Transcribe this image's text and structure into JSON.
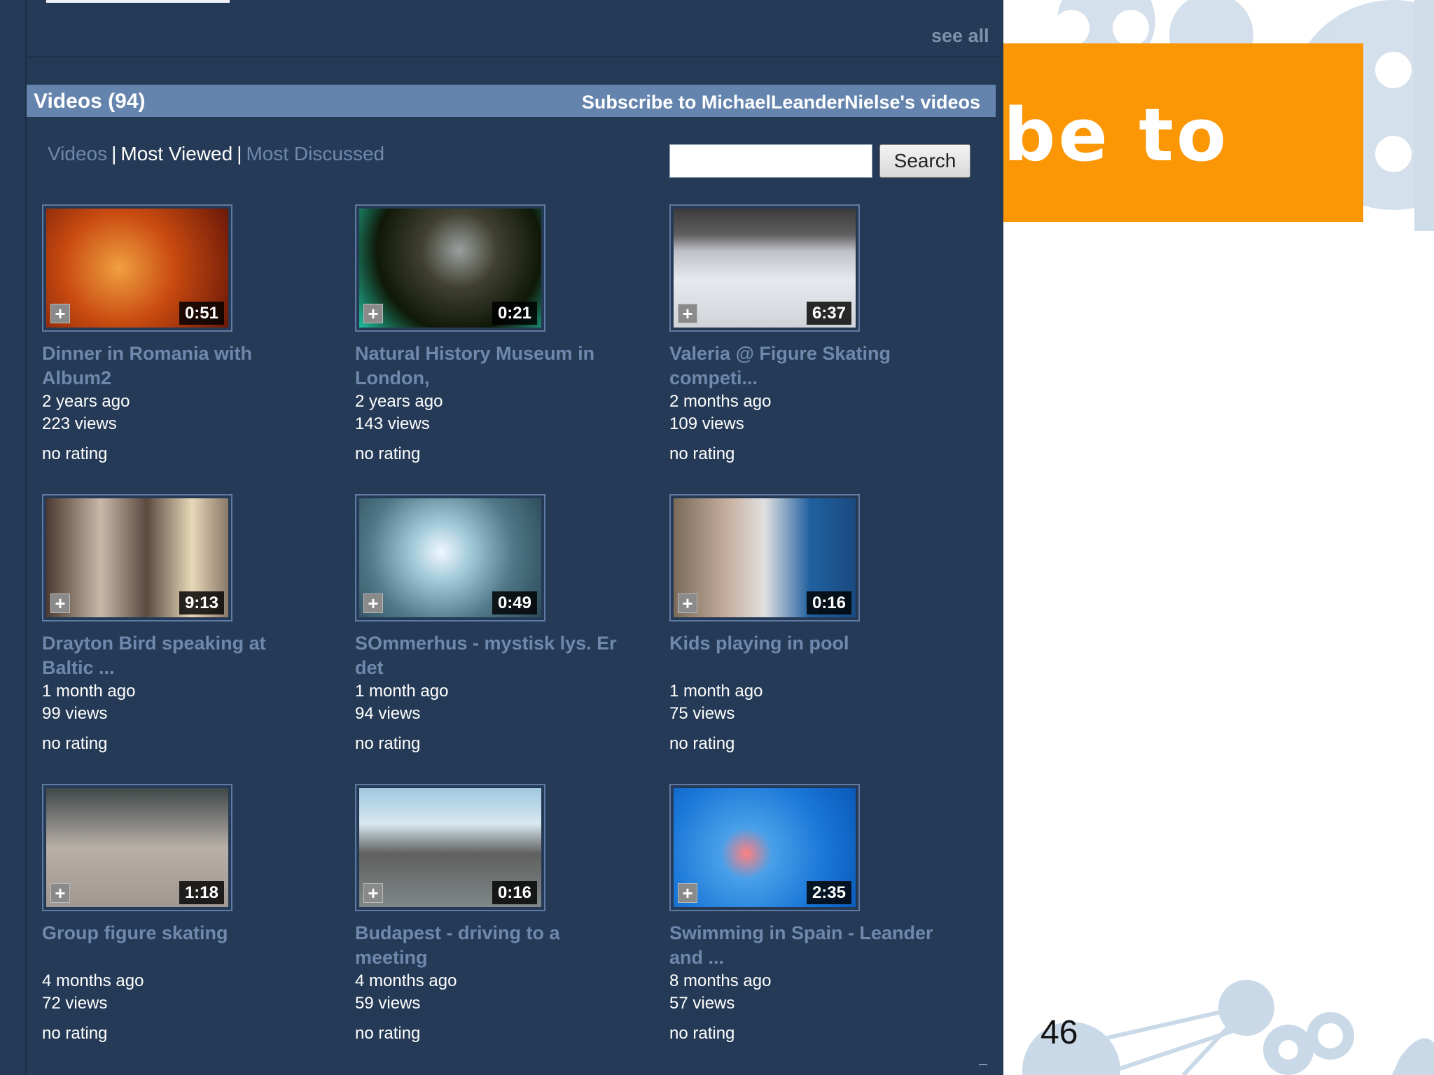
{
  "panel": {
    "see_all": "see all",
    "header": {
      "title": "Videos (94)",
      "subscribe": "Subscribe to MichaelLeanderNielse's videos"
    },
    "tabs": [
      {
        "label": "Videos",
        "active": false
      },
      {
        "label": "Most Viewed",
        "active": true
      },
      {
        "label": "Most Discussed",
        "active": false
      }
    ],
    "tab_separator": "|",
    "search": {
      "value": "",
      "placeholder": "",
      "button": "Search"
    },
    "add_icon": "plus-icon",
    "videos": [
      {
        "title": "Dinner in Romania with Album2",
        "duration": "0:51",
        "age": "2 years ago",
        "views": "223 views",
        "rating": "no rating"
      },
      {
        "title": "Natural History Museum in London,",
        "duration": "0:21",
        "age": "2 years ago",
        "views": "143 views",
        "rating": "no rating"
      },
      {
        "title": "Valeria @ Figure Skating competi...",
        "duration": "6:37",
        "age": "2 months ago",
        "views": "109 views",
        "rating": "no rating"
      },
      {
        "title": "Drayton Bird speaking at Baltic ...",
        "duration": "9:13",
        "age": "1 month ago",
        "views": "99 views",
        "rating": "no rating"
      },
      {
        "title": "SOmmerhus - mystisk lys. Er det",
        "duration": "0:49",
        "age": "1 month ago",
        "views": "94 views",
        "rating": "no rating"
      },
      {
        "title": "Kids playing in pool",
        "duration": "0:16",
        "age": "1 month ago",
        "views": "75 views",
        "rating": "no rating"
      },
      {
        "title": "Group figure skating",
        "duration": "1:18",
        "age": "4 months ago",
        "views": "72 views",
        "rating": "no rating"
      },
      {
        "title": "Budapest - driving to a meeting",
        "duration": "0:16",
        "age": "4 months ago",
        "views": "59 views",
        "rating": "no rating"
      },
      {
        "title": "Swimming in Spain - Leander and ...",
        "duration": "2:35",
        "age": "8 months ago",
        "views": "57 views",
        "rating": "no rating"
      }
    ]
  },
  "slide": {
    "title_fragment": "be  to",
    "page_number": "46",
    "accent_color": "#fb9605"
  }
}
